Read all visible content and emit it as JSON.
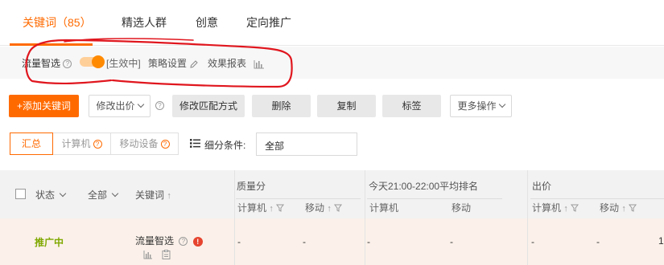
{
  "tabs": [
    {
      "label": "关键词（85）",
      "active": true
    },
    {
      "label": "精选人群",
      "active": false
    },
    {
      "label": "创意",
      "active": false
    },
    {
      "label": "定向推广",
      "active": false
    }
  ],
  "smart": {
    "label": "流量智选",
    "toggle_on": true,
    "status": "[生效中]",
    "strategy": "策略设置",
    "report": "效果报表",
    "accent": "#ff6a00",
    "annotation_color": "#e0161e"
  },
  "toolbar": {
    "add": "+添加关键词",
    "modify_bid": "修改出价",
    "modify_match": "修改匹配方式",
    "delete": "删除",
    "copy": "复制",
    "tag": "标签",
    "more": "更多操作"
  },
  "filter": {
    "summary": "汇总",
    "computer": "计算机",
    "mobile": "移动设备",
    "detail_label": "细分条件:",
    "detail_value": "全部"
  },
  "table": {
    "status": "状态",
    "all": "全部",
    "keyword": "关键词",
    "quality": "质量分",
    "rank": "今天21:00-22:00平均排名",
    "bid": "出价",
    "computer": "计算机",
    "mobile": "移动",
    "row": {
      "status": "推广中",
      "keyword": "流量智选",
      "dashes": [
        "-",
        "-",
        "-",
        "-",
        "-",
        "-"
      ],
      "trailing": "1"
    }
  }
}
